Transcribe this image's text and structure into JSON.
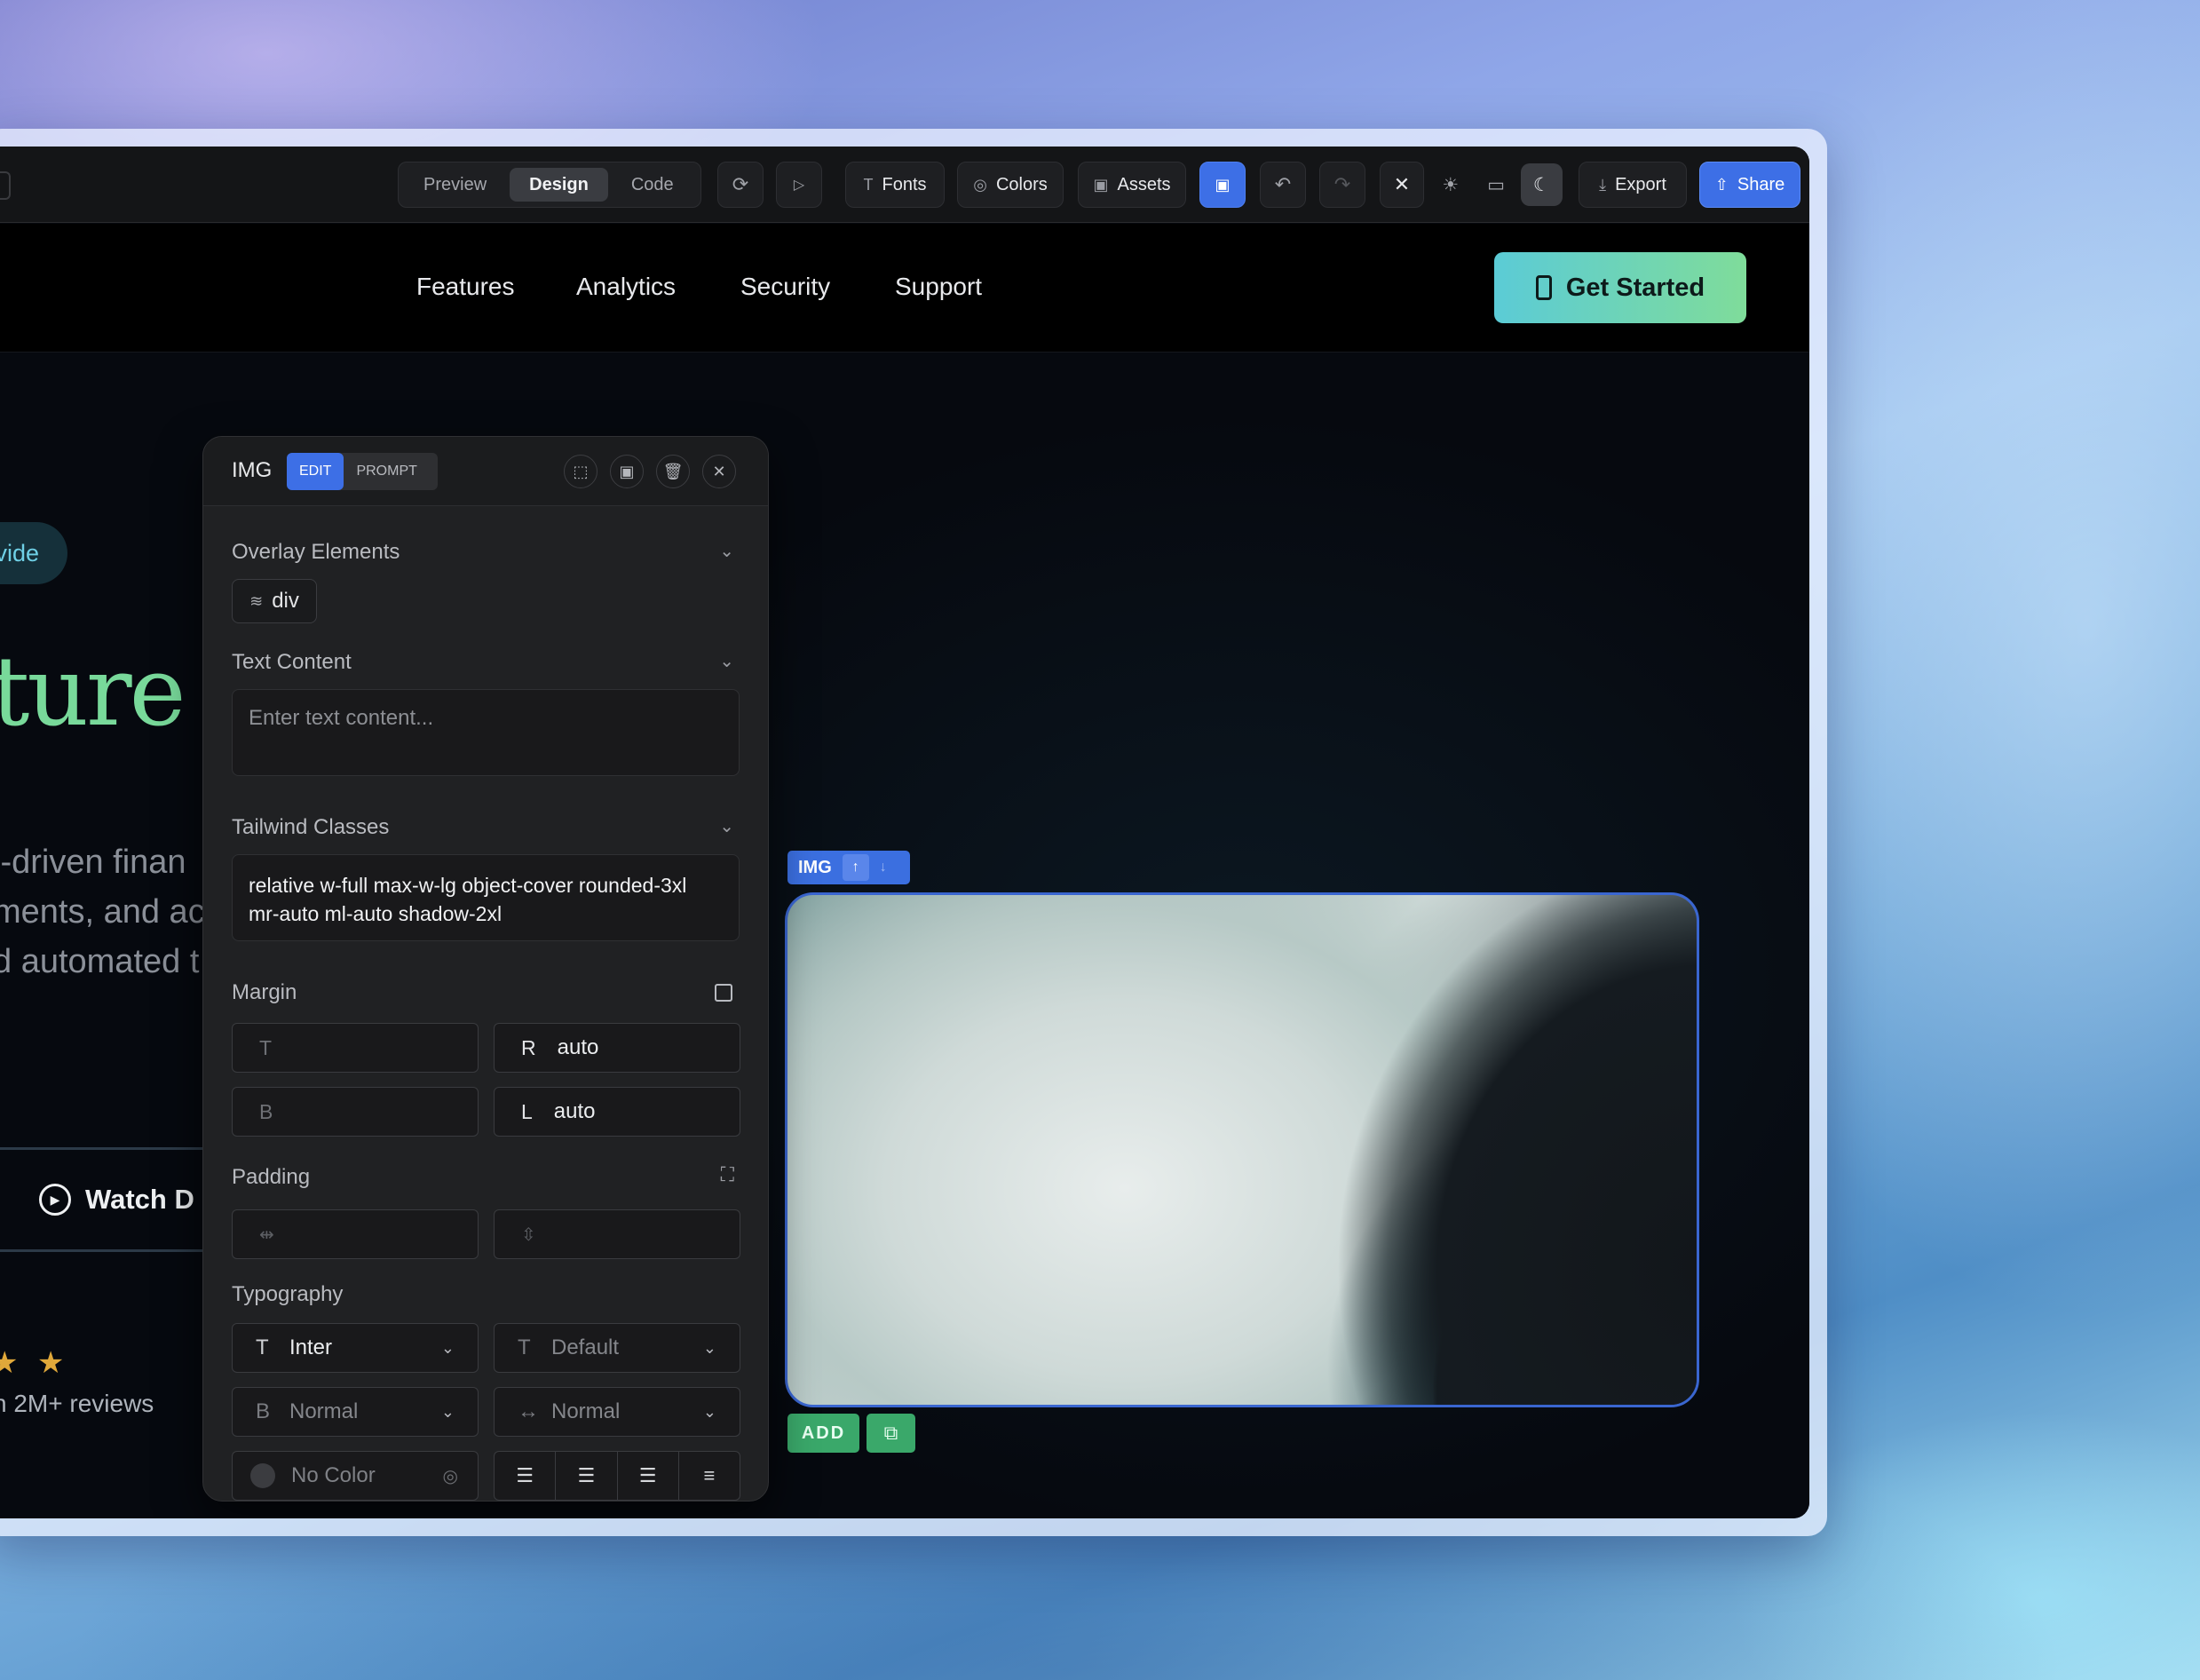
{
  "toolbar": {
    "modes": [
      "Preview",
      "Design",
      "Code"
    ],
    "active_mode": "Design",
    "fonts_label": "Fonts",
    "colors_label": "Colors",
    "assets_label": "Assets",
    "export_label": "Export",
    "share_label": "Share"
  },
  "site_nav": {
    "links": [
      "Features",
      "Analytics",
      "Security",
      "Support"
    ],
    "cta_label": "Get Started"
  },
  "hero": {
    "pill_text": "vide",
    "title_fragment": "ture",
    "desc_lines": [
      "l-driven finan",
      "ments, and ac",
      "d automated t"
    ],
    "watch_label": "Watch D",
    "stars": "★ ★",
    "reviews_text": "n 2M+ reviews"
  },
  "selection": {
    "tag_label": "IMG",
    "add_label": "ADD"
  },
  "panel": {
    "title": "IMG",
    "tabs": [
      "EDIT",
      "PROMPT"
    ],
    "active_tab": "EDIT",
    "overlay": {
      "label": "Overlay Elements",
      "chip": "div"
    },
    "text_content": {
      "label": "Text Content",
      "placeholder": "Enter text content..."
    },
    "tailwind": {
      "label": "Tailwind Classes",
      "value": "relative w-full max-w-lg object-cover rounded-3xl mr-auto ml-auto shadow-2xl"
    },
    "margin": {
      "label": "Margin",
      "top_label": "T",
      "right_label": "R",
      "right_value": "auto",
      "bottom_label": "B",
      "left_label": "L",
      "left_value": "auto"
    },
    "padding": {
      "label": "Padding"
    },
    "typography": {
      "label": "Typography",
      "font": "Inter",
      "size": "Default",
      "weight": "Normal",
      "spacing": "Normal",
      "color": "No Color"
    }
  },
  "colors": {
    "accent": "#3d6fe6",
    "cta_gradient_start": "#5bcbd6",
    "cta_gradient_end": "#7fdc9a",
    "hero_title": "#78d99a",
    "add_green": "#3aa86a",
    "star": "#e0a83a"
  }
}
